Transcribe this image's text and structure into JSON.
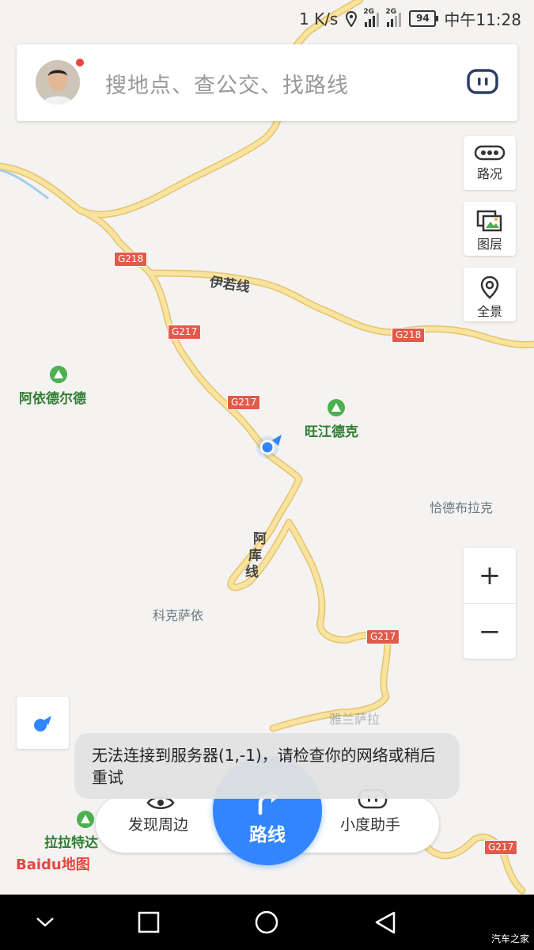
{
  "status_bar": {
    "speed": "1 K/s",
    "net1": "2G",
    "net2": "2G",
    "battery": "94",
    "time": "中午11:28"
  },
  "search": {
    "placeholder": "搜地点、查公交、找路线"
  },
  "side_buttons": {
    "traffic": "路况",
    "layers": "图层",
    "panorama": "全景"
  },
  "zoom": {
    "in": "+",
    "out": "−"
  },
  "map_labels": {
    "road_yiruo": "伊若线",
    "road_aku_1": "阿",
    "road_aku_2": "库",
    "road_aku_3": "线",
    "g218_a": "G218",
    "g218_b": "G218",
    "g217_a": "G217",
    "g217_b": "G217",
    "g217_c": "G217",
    "g217_d": "G217",
    "poi_ayi": "阿依德尔德",
    "poi_wangjiang": "旺江德克",
    "poi_qiade": "恰德布拉克",
    "poi_kekesayi": "科克萨依",
    "poi_lala": "拉拉特达",
    "poi_yalan": "雅兰萨拉"
  },
  "toast": {
    "message": "无法连接到服务器(1,-1)，请检查你的网络或稍后重试"
  },
  "bottom_bar": {
    "discover": "发现周边",
    "route": "路线",
    "assistant": "小度助手"
  },
  "logo": {
    "brand": "Baidu地图"
  },
  "watermark": "汽车之家",
  "colors": {
    "road": "#f6dc8a",
    "road_edge": "#e8c66a",
    "accent": "#3385ff",
    "poi_green": "#2f7d32"
  }
}
